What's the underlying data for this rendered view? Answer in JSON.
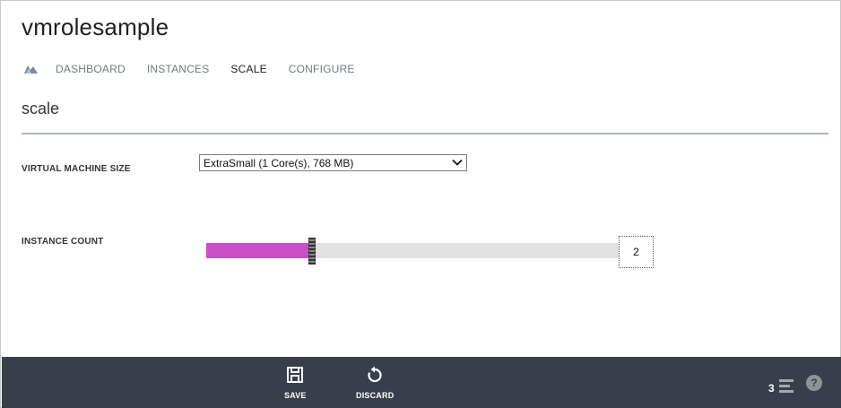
{
  "app": {
    "title": "vmrolesample"
  },
  "nav": {
    "icon": "cloud-service-icon",
    "tabs": [
      {
        "label": "DASHBOARD",
        "active": false
      },
      {
        "label": "INSTANCES",
        "active": false
      },
      {
        "label": "SCALE",
        "active": true
      },
      {
        "label": "CONFIGURE",
        "active": false
      }
    ]
  },
  "main": {
    "section_title": "scale",
    "vm_size": {
      "label": "VIRTUAL MACHINE SIZE",
      "selected": "ExtraSmall (1 Core(s), 768 MB)"
    },
    "instance_count": {
      "label": "INSTANCE COUNT",
      "value": "2",
      "slider_fraction": 0.25,
      "fill_color": "#c94fc9"
    }
  },
  "commandbar": {
    "save_label": "SAVE",
    "discard_label": "DISCARD",
    "notification_count": "3",
    "help_symbol": "?",
    "background": "#393f4a"
  }
}
